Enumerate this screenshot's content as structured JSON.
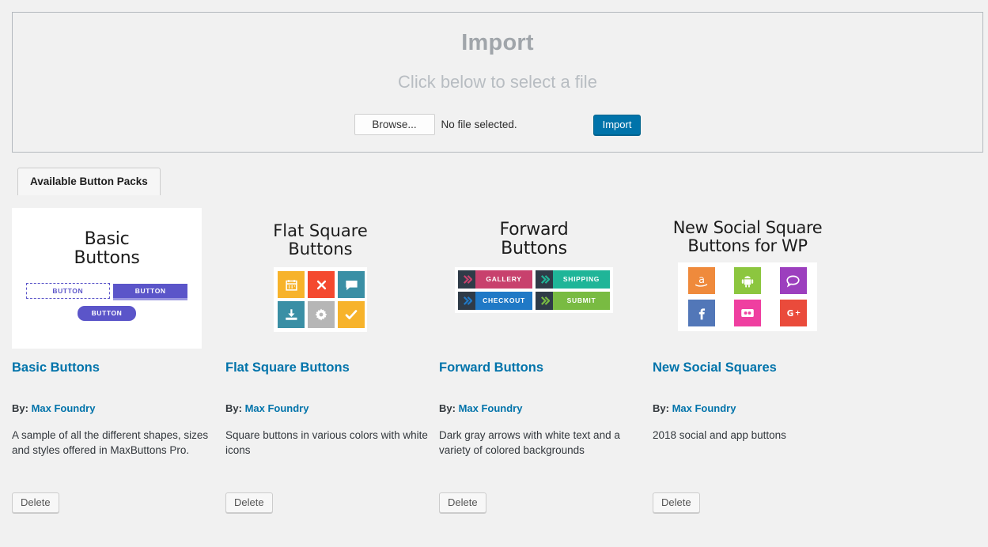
{
  "ghost_text": "",
  "import": {
    "title": "Import",
    "subtitle": "Click below to select a file",
    "browse_label": "Browse...",
    "file_status": "No file selected.",
    "import_label": "Import",
    "accent_color": "#0073aa"
  },
  "tabs": [
    {
      "label": "Available Button Packs",
      "active": true
    }
  ],
  "packs": [
    {
      "name": "Basic Buttons",
      "by_label": "By:",
      "author": "Max Foundry",
      "description": "A sample of all the different shapes, sizes and styles offered in MaxButtons Pro.",
      "delete_label": "Delete",
      "thumb": {
        "type": "basic",
        "title_line1": "Basic",
        "title_line2": "Buttons",
        "background": "#ffffff",
        "accent": "#5b55c9",
        "buttons": [
          {
            "label": "BUTTON",
            "style": "outline-dashed"
          },
          {
            "label": "BUTTON",
            "style": "solid-3d"
          },
          {
            "label": "BUTTON",
            "style": "rounded"
          }
        ]
      }
    },
    {
      "name": "Flat Square Buttons",
      "by_label": "By:",
      "author": "Max Foundry",
      "description": "Square buttons in various colors with white icons",
      "delete_label": "Delete",
      "thumb": {
        "type": "flat-square",
        "title_line1": "Flat Square",
        "title_line2": "Buttons",
        "background": "#f1f1f1",
        "cells": [
          {
            "icon": "calendar-icon",
            "color": "#f7b32b"
          },
          {
            "icon": "close-icon",
            "color": "#f4492f"
          },
          {
            "icon": "comment-icon",
            "color": "#3a8fa5"
          },
          {
            "icon": "download-icon",
            "color": "#3a8fa5"
          },
          {
            "icon": "gear-icon",
            "color": "#b6b6b6"
          },
          {
            "icon": "check-icon",
            "color": "#f7b32b"
          }
        ]
      }
    },
    {
      "name": "Forward Buttons",
      "by_label": "By:",
      "author": "Max Foundry",
      "description": "Dark gray arrows with white text and a variety of colored backgrounds",
      "delete_label": "Delete",
      "thumb": {
        "type": "forward",
        "title_line1": "Forward",
        "title_line2": "Buttons",
        "background": "#f1f1f1",
        "arrow_color": "#2f3b48",
        "buttons": [
          {
            "label": "GALLERY",
            "color": "#c8416d"
          },
          {
            "label": "SHIPPING",
            "color": "#1fb598"
          },
          {
            "label": "CHECKOUT",
            "color": "#2079c6"
          },
          {
            "label": "SUBMIT",
            "color": "#79bb42"
          }
        ]
      }
    },
    {
      "name": "New Social Squares",
      "by_label": "By:",
      "author": "Max Foundry",
      "description": "2018 social and app buttons",
      "delete_label": "Delete",
      "thumb": {
        "type": "social",
        "title_line1": "New Social Square",
        "title_line2": "Buttons for WP",
        "background": "#f1f1f1",
        "cells": [
          {
            "icon": "amazon-icon",
            "color": "#ef8a3c"
          },
          {
            "icon": "android-icon",
            "color": "#8cc63f"
          },
          {
            "icon": "comment-icon",
            "color": "#9c3fbe"
          },
          {
            "icon": "facebook-icon",
            "color": "#5277b8"
          },
          {
            "icon": "flickr-icon",
            "color": "#ef3fa0"
          },
          {
            "icon": "google-plus-icon",
            "color": "#ea4b3b"
          }
        ]
      }
    }
  ]
}
